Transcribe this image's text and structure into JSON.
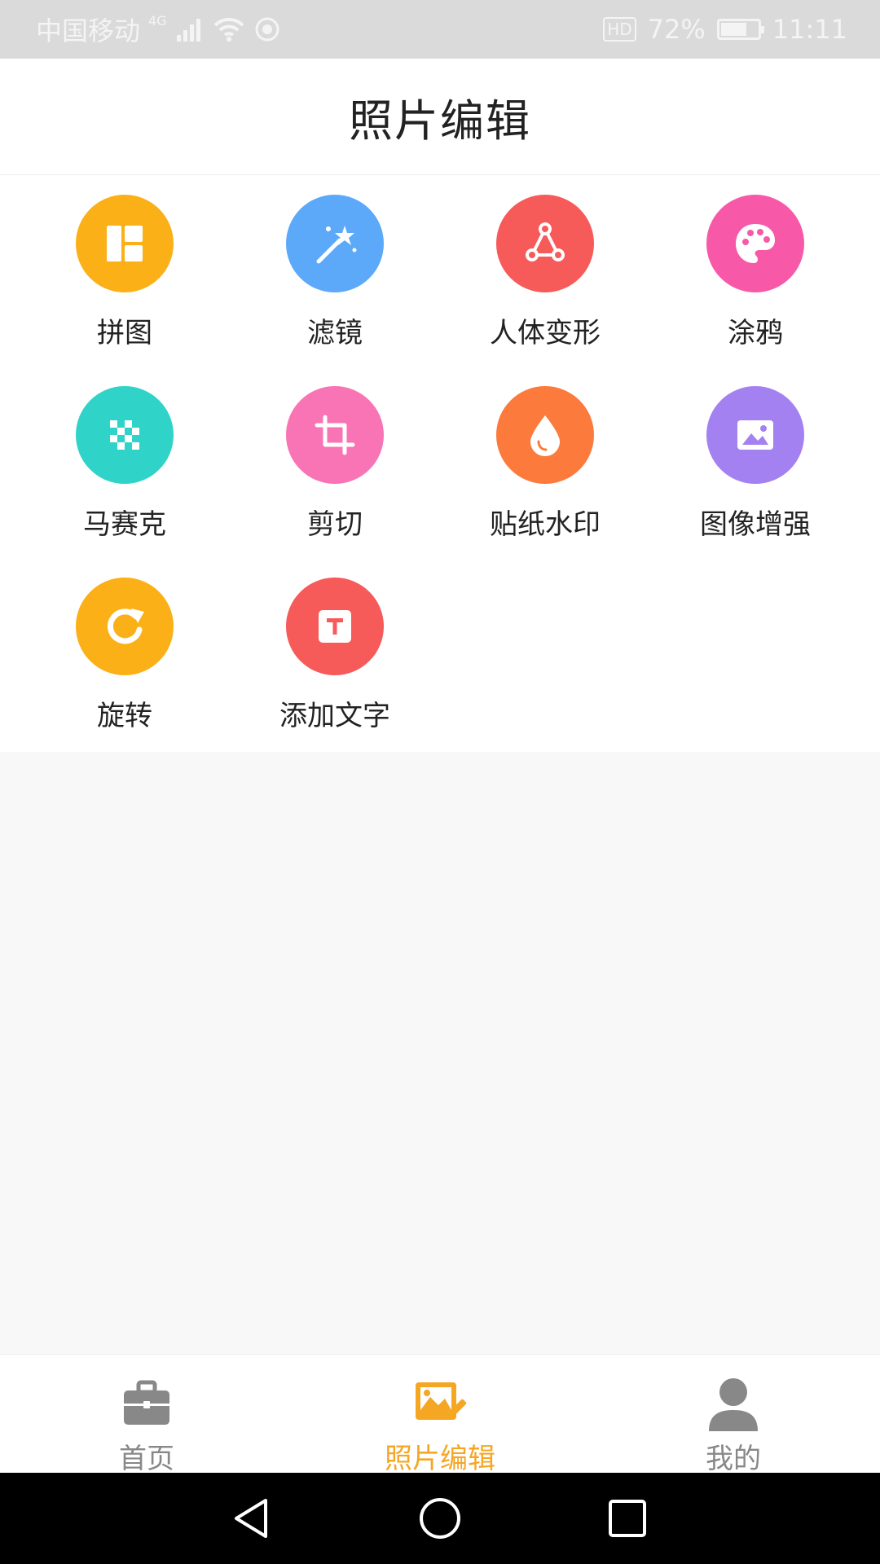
{
  "status_bar": {
    "carrier": "中国移动",
    "network": "4G",
    "hd": "HD",
    "battery_percent": "72%",
    "battery_level": 0.72,
    "time": "11:11"
  },
  "header": {
    "title": "照片编辑"
  },
  "tools": [
    {
      "label": "拼图",
      "icon": "collage-layout-icon",
      "color": "#FBB017"
    },
    {
      "label": "滤镜",
      "icon": "magic-wand-icon",
      "color": "#5CA9FA"
    },
    {
      "label": "人体变形",
      "icon": "body-reshape-icon",
      "color": "#F65A59"
    },
    {
      "label": "涂鸦",
      "icon": "palette-icon",
      "color": "#F759A8"
    },
    {
      "label": "马赛克",
      "icon": "mosaic-icon",
      "color": "#2FD3C8"
    },
    {
      "label": "剪切",
      "icon": "crop-icon",
      "color": "#F874B5"
    },
    {
      "label": "贴纸水印",
      "icon": "water-drop-icon",
      "color": "#FC7A3B"
    },
    {
      "label": "图像增强",
      "icon": "image-icon",
      "color": "#A481F0"
    },
    {
      "label": "旋转",
      "icon": "rotate-icon",
      "color": "#FBB017"
    },
    {
      "label": "添加文字",
      "icon": "text-icon",
      "color": "#F65A59"
    }
  ],
  "bottom_nav": {
    "items": [
      {
        "label": "首页",
        "icon": "briefcase-icon",
        "active": false
      },
      {
        "label": "照片编辑",
        "icon": "photo-edit-icon",
        "active": true
      },
      {
        "label": "我的",
        "icon": "user-icon",
        "active": false
      }
    ],
    "active_color": "#F5A623",
    "inactive_color": "#888888"
  }
}
